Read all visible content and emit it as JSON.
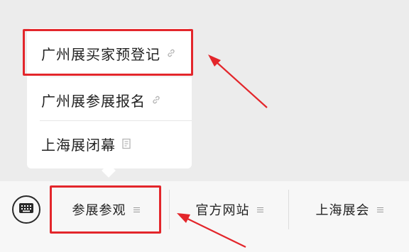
{
  "popup_menu": {
    "items": [
      {
        "label": "广州展买家预登记",
        "icon": "link-icon"
      },
      {
        "label": "广州展参展报名",
        "icon": "link-icon"
      },
      {
        "label": "上海展闭幕",
        "icon": "document-icon"
      }
    ]
  },
  "bottom_bar": {
    "keyboard_icon": "keyboard-icon",
    "tabs": [
      {
        "label": "参展参观",
        "icon": "menu-lines-icon"
      },
      {
        "label": "官方网站",
        "icon": "menu-lines-icon"
      },
      {
        "label": "上海展会",
        "icon": "menu-lines-icon"
      }
    ]
  },
  "colors": {
    "highlight": "#e3262b",
    "background": "#ececec",
    "menu_background": "#ffffff",
    "bar_background": "#f7f7f7"
  }
}
